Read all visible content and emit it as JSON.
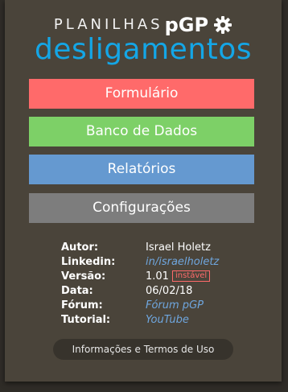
{
  "brand": {
    "prefix": "PLANILHAS",
    "suffix": "pGP",
    "title": "desligamentos"
  },
  "menu": [
    {
      "label": "Formulário",
      "color": "#ff6a6a"
    },
    {
      "label": "Banco de Dados",
      "color": "#7dd067"
    },
    {
      "label": "Relatórios",
      "color": "#6599d0"
    },
    {
      "label": "Configurações",
      "color": "#7d7d7d"
    }
  ],
  "info": {
    "autor_label": "Autor:",
    "autor_value": "Israel Holetz",
    "linkedin_label": "Linkedin:",
    "linkedin_value": "in/israelholetz",
    "versao_label": "Versão:",
    "versao_value": "1.01",
    "versao_badge": "instável",
    "data_label": "Data:",
    "data_value": "06/02/18",
    "forum_label": "Fórum:",
    "forum_value": "Fórum pGP",
    "tutorial_label": "Tutorial:",
    "tutorial_value": "YouTube"
  },
  "footer": {
    "terms_label": "Informações e Termos de Uso"
  },
  "icons": {
    "brand_icon": "gear-icon"
  },
  "colors": {
    "accent": "#14a6e6",
    "link": "#6fa6de",
    "badge": "#ff6a6a"
  }
}
